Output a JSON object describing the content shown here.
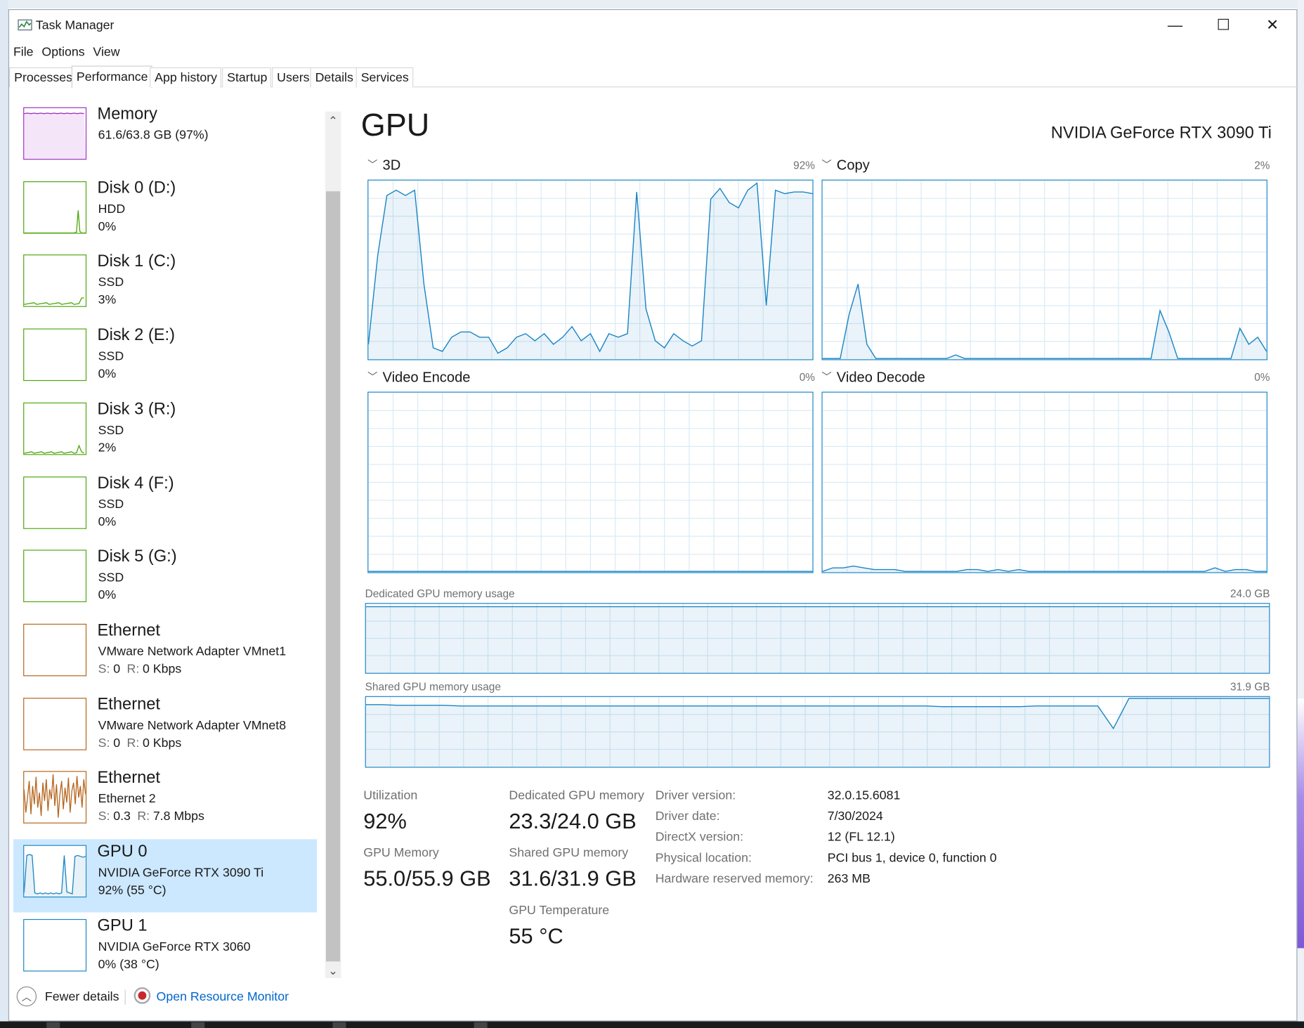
{
  "window": {
    "title": "Task Manager"
  },
  "controls": {
    "minimize_glyph": "—",
    "maximize_glyph": "☐",
    "close_glyph": "✕"
  },
  "menu": [
    "File",
    "Options",
    "View"
  ],
  "tabs": [
    "Processes",
    "Performance",
    "App history",
    "Startup",
    "Users",
    "Details",
    "Services"
  ],
  "active_tab": "Performance",
  "sidebar": {
    "items": [
      {
        "title": "Memory",
        "line1": "61.6/63.8 GB (97%)",
        "line2": "",
        "color": "#9e2fc0",
        "trace": "memory"
      },
      {
        "title": "Disk 0 (D:)",
        "line1": "HDD",
        "line2": "0%",
        "color": "#4da60c",
        "trace": "disk0"
      },
      {
        "title": "Disk 1 (C:)",
        "line1": "SSD",
        "line2": "3%",
        "color": "#4da60c",
        "trace": "disk1"
      },
      {
        "title": "Disk 2 (E:)",
        "line1": "SSD",
        "line2": "0%",
        "color": "#4da60c",
        "trace": "flat"
      },
      {
        "title": "Disk 3 (R:)",
        "line1": "SSD",
        "line2": "2%",
        "color": "#4da60c",
        "trace": "disk3"
      },
      {
        "title": "Disk 4 (F:)",
        "line1": "SSD",
        "line2": "0%",
        "color": "#4da60c",
        "trace": "flat"
      },
      {
        "title": "Disk 5 (G:)",
        "line1": "SSD",
        "line2": "0%",
        "color": "#4da60c",
        "trace": "flat"
      },
      {
        "title": "Ethernet",
        "line1": "VMware Network Adapter VMnet1",
        "line2_s": "S:",
        "line2_sv": "0",
        "line2_r": "R:",
        "line2_rv": "0 Kbps",
        "color": "#b5651d",
        "trace": "flat"
      },
      {
        "title": "Ethernet",
        "line1": "VMware Network Adapter VMnet8",
        "line2_s": "S:",
        "line2_sv": "0",
        "line2_r": "R:",
        "line2_rv": "0 Kbps",
        "color": "#b5651d",
        "trace": "flat"
      },
      {
        "title": "Ethernet",
        "line1": "Ethernet 2",
        "line2_s": "S:",
        "line2_sv": "0.3",
        "line2_r": "R:",
        "line2_rv": "7.8 Mbps",
        "color": "#b5651d",
        "trace": "eth2"
      },
      {
        "title": "GPU 0",
        "line1": "NVIDIA GeForce RTX 3090 Ti",
        "line2": "92% (55 °C)",
        "color": "#1a85c5",
        "trace": "gpu0"
      },
      {
        "title": "GPU 1",
        "line1": "NVIDIA GeForce RTX 3060",
        "line2": "0% (38 °C)",
        "color": "#1a85c5",
        "trace": "flat"
      }
    ],
    "selected_index": 10
  },
  "footer": {
    "fewer_details": "Fewer details",
    "resource_monitor": "Open Resource Monitor"
  },
  "main": {
    "heading": "GPU",
    "model": "NVIDIA GeForce RTX 3090 Ti",
    "engines": [
      {
        "name": "3D",
        "percent": "92%"
      },
      {
        "name": "Copy",
        "percent": "2%"
      },
      {
        "name": "Video Encode",
        "percent": "0%"
      },
      {
        "name": "Video Decode",
        "percent": "0%"
      }
    ],
    "dedicated_label": "Dedicated GPU memory usage",
    "dedicated_max": "24.0 GB",
    "shared_label": "Shared GPU memory usage",
    "shared_max": "31.9 GB",
    "stats": {
      "utilization_label": "Utilization",
      "utilization_value": "92%",
      "dedicated_label": "Dedicated GPU memory",
      "dedicated_value": "23.3/24.0 GB",
      "gpu_memory_label": "GPU Memory",
      "gpu_memory_value": "55.0/55.9 GB",
      "shared_label": "Shared GPU memory",
      "shared_value": "31.6/31.9 GB",
      "temp_label": "GPU Temperature",
      "temp_value": "55 °C"
    },
    "info": [
      {
        "key": "Driver version:",
        "value": "32.0.15.6081"
      },
      {
        "key": "Driver date:",
        "value": "7/30/2024"
      },
      {
        "key": "DirectX version:",
        "value": "12 (FL 12.1)"
      },
      {
        "key": "Physical location:",
        "value": "PCI bus 1, device 0, function 0"
      },
      {
        "key": "Hardware reserved memory:",
        "value": "263 MB"
      }
    ]
  },
  "chart_data": [
    {
      "type": "area",
      "series": [
        {
          "values": [
            8,
            58,
            92,
            95,
            92,
            95,
            42,
            6,
            4,
            12,
            15,
            15,
            12,
            12,
            3,
            6,
            12,
            14,
            10,
            14,
            8,
            12,
            18,
            10,
            14,
            4,
            14,
            12,
            14,
            94,
            28,
            10,
            6,
            14,
            10,
            7,
            10,
            90,
            96,
            88,
            85,
            95,
            99,
            30,
            95,
            93,
            94,
            94,
            93
          ]
        }
      ],
      "ylim": [
        0,
        100
      ]
    },
    {
      "type": "area",
      "series": [
        {
          "values": [
            0,
            0,
            0,
            25,
            42,
            8,
            0,
            0,
            0,
            0,
            0,
            0,
            0,
            0,
            0,
            2,
            0,
            0,
            0,
            0,
            0,
            0,
            0,
            0,
            0,
            0,
            0,
            0,
            0,
            0,
            0,
            0,
            0,
            0,
            0,
            0,
            0,
            0,
            27,
            15,
            0,
            0,
            0,
            0,
            0,
            0,
            0,
            17,
            8,
            12,
            4
          ]
        }
      ],
      "ylim": [
        0,
        100
      ]
    },
    {
      "type": "area",
      "series": [
        {
          "values": [
            0,
            0,
            0,
            0,
            0,
            0,
            0,
            0,
            0,
            0,
            0,
            0,
            0,
            0,
            0,
            0,
            0,
            0,
            0,
            0
          ]
        }
      ],
      "ylim": [
        0,
        100
      ]
    },
    {
      "type": "area",
      "series": [
        {
          "values": [
            0,
            2,
            2,
            3,
            2,
            1,
            1,
            1,
            0,
            0,
            0,
            0,
            0,
            0,
            1,
            1,
            0,
            1,
            0,
            1,
            0,
            0,
            0,
            0,
            0,
            0,
            0,
            0,
            0,
            0,
            0,
            0,
            0,
            0,
            0,
            0,
            0,
            0,
            2,
            0,
            1,
            1,
            0,
            0
          ]
        }
      ],
      "ylim": [
        0,
        100
      ]
    },
    {
      "type": "area",
      "series": [
        {
          "values": [
            97,
            97,
            97,
            97,
            97,
            97,
            97,
            97,
            97,
            97,
            97,
            97,
            97,
            97,
            97,
            97,
            97,
            97,
            97,
            97,
            97,
            97,
            97,
            97,
            97,
            97,
            97,
            97,
            97,
            97
          ]
        }
      ],
      "ylim": [
        0,
        100
      ]
    },
    {
      "type": "area",
      "series": [
        {
          "values": [
            90,
            90,
            89,
            89,
            89,
            89,
            88,
            88,
            88,
            88,
            88,
            88,
            88,
            88,
            88,
            88,
            88,
            88,
            88,
            88,
            88,
            88,
            88,
            88,
            88,
            88,
            88,
            88,
            88,
            88,
            88,
            88,
            88,
            88,
            88,
            88,
            88,
            87,
            87,
            87,
            87,
            87,
            87,
            88,
            88,
            88,
            88,
            88,
            55,
            99,
            99,
            99,
            99,
            99,
            99,
            99,
            99,
            99,
            99
          ]
        }
      ],
      "ylim": [
        0,
        100
      ]
    }
  ]
}
